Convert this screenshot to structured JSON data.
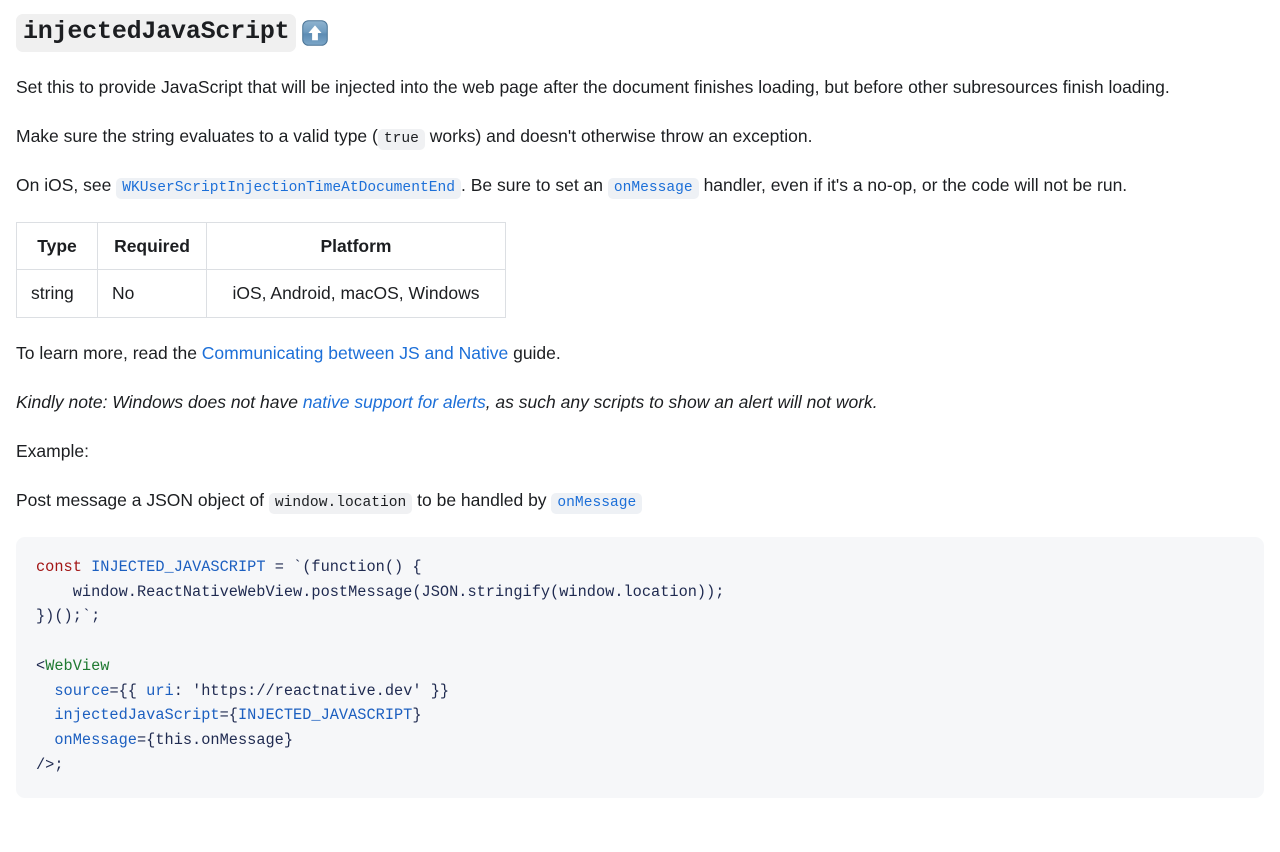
{
  "heading": {
    "title": "injectedJavaScript",
    "emoji_name": "up-arrow-emoji",
    "emoji_char": "⬆️"
  },
  "paragraphs": {
    "intro": "Set this to provide JavaScript that will be injected into the web page after the document finishes loading, but before other subresources finish loading.",
    "valid_type_before": "Make sure the string evaluates to a valid type (",
    "valid_type_code": "true",
    "valid_type_after": " works) and doesn't otherwise throw an exception.",
    "ios_before": "On iOS, see ",
    "ios_code_link": "WKUserScriptInjectionTimeAtDocumentEnd",
    "ios_middle": ". Be sure to set an ",
    "ios_code_link2": "onMessage",
    "ios_after": " handler, even if it's a no-op, or the code will not be run.",
    "learn_before": "To learn more, read the ",
    "learn_link": "Communicating between JS and Native",
    "learn_after": " guide.",
    "note_before": "Kindly note: Windows does not have ",
    "note_link": "native support for alerts",
    "note_after": ", as such any scripts to show an alert will not work.",
    "example_label": "Example:",
    "postmsg_before": "Post message a JSON object of ",
    "postmsg_code": "window.location",
    "postmsg_middle": " to be handled by ",
    "postmsg_code2": "onMessage"
  },
  "table": {
    "headers": [
      "Type",
      "Required",
      "Platform"
    ],
    "rows": [
      [
        "string",
        "No",
        "iOS, Android, macOS, Windows"
      ]
    ]
  },
  "code_block": {
    "language": "jsx",
    "lines": [
      "const INJECTED_JAVASCRIPT = `(function() {",
      "    window.ReactNativeWebView.postMessage(JSON.stringify(window.location));",
      "})();`;",
      "",
      "<WebView",
      "  source={{ uri: 'https://reactnative.dev' }}",
      "  injectedJavaScript={INJECTED_JAVASCRIPT}",
      "  onMessage={this.onMessage}",
      "/>;"
    ],
    "tokens": {
      "const": "const",
      "injected_javascript": "INJECTED_JAVASCRIPT",
      "assign": " = `(function() {",
      "line2": "    window.ReactNativeWebView.postMessage(JSON.stringify(window.location));",
      "line3": "})();`;",
      "tag_open": "<",
      "tag_name": "WebView",
      "attr_source": "  source",
      "attr_source_val": "={{ ",
      "attr_uri": "uri",
      "attr_uri_sep": ": ",
      "attr_uri_str": "'https://reactnative.dev'",
      "attr_source_end": " }}",
      "attr_injected": "  injectedJavaScript",
      "attr_injected_eq": "={",
      "attr_injected_val": "INJECTED_JAVASCRIPT",
      "attr_injected_end": "}",
      "attr_onmessage": "  onMessage",
      "attr_onmessage_eq": "={this.",
      "attr_onmessage_val": "onMessage",
      "attr_onmessage_end": "}",
      "tag_close": "/>;"
    }
  },
  "colors": {
    "link": "#1c6fd8",
    "code_bg": "#f6f7f9",
    "inline_code_bg": "#f0f1f3",
    "keyword": "#a31515",
    "variable": "#1c5fc0",
    "tag": "#1f7a32",
    "text": "#1c1e21",
    "table_border": "#dcdfe3"
  }
}
